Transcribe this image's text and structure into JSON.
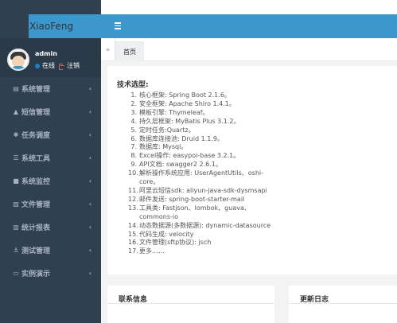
{
  "app": {
    "logo_text": "XiaoFeng"
  },
  "user": {
    "name": "admin",
    "status_label": "在线",
    "logout_label": "注销"
  },
  "sidebar": {
    "items": [
      {
        "icon": "doc-icon",
        "glyph": "▤",
        "label": "系统管理"
      },
      {
        "icon": "bell-icon",
        "glyph": "▲",
        "label": "短信管理"
      },
      {
        "icon": "asterisk-icon",
        "glyph": "✱",
        "label": "任务调度"
      },
      {
        "icon": "list-icon",
        "glyph": "☰",
        "label": "系统工具"
      },
      {
        "icon": "video-icon",
        "glyph": "■",
        "label": "系统监控"
      },
      {
        "icon": "file-icon",
        "glyph": "▧",
        "label": "文件管理"
      },
      {
        "icon": "bar-chart-icon",
        "glyph": "▥",
        "label": "统计报表"
      },
      {
        "icon": "anchor-icon",
        "glyph": "⚓",
        "label": "测试管理"
      },
      {
        "icon": "desktop-icon",
        "glyph": "▭",
        "label": "实例演示"
      }
    ],
    "chevron": "‹"
  },
  "tabs": {
    "back_glyph": "«",
    "active_label": "首页"
  },
  "main": {
    "section_title": "技术选型:",
    "tech_list": [
      "核心框架: Spring Boot 2.1.6。",
      "安全框架: Apache Shiro 1.4.1。",
      "模板引擎: Thymeleaf。",
      "持久层框架: MyBatis Plus 3.1.2。",
      "定时任务:Quartz。",
      "数据库连接池: Druid 1.1.9。",
      "数据库: Mysql。",
      "Excel操作: easypoi-base 3.2.1。",
      "API文档: swagger2 2.6.1。",
      "解析操作系统应用: UserAgentUtils、oshi-core。",
      "阿里云短信sdk: aliyun-java-sdk-dysmsapi",
      "邮件发送: spring-boot-starter-mail",
      "工具类: Fastjson、lombok、guava、commons-io",
      "动态数据源(多数据源): dynamic-datasource",
      "代码生成: velocity",
      "文件管理(sftp协议): jsch",
      "更多……"
    ]
  },
  "cards": {
    "contact_title": "联系信息",
    "changelog_title": "更新日志"
  }
}
